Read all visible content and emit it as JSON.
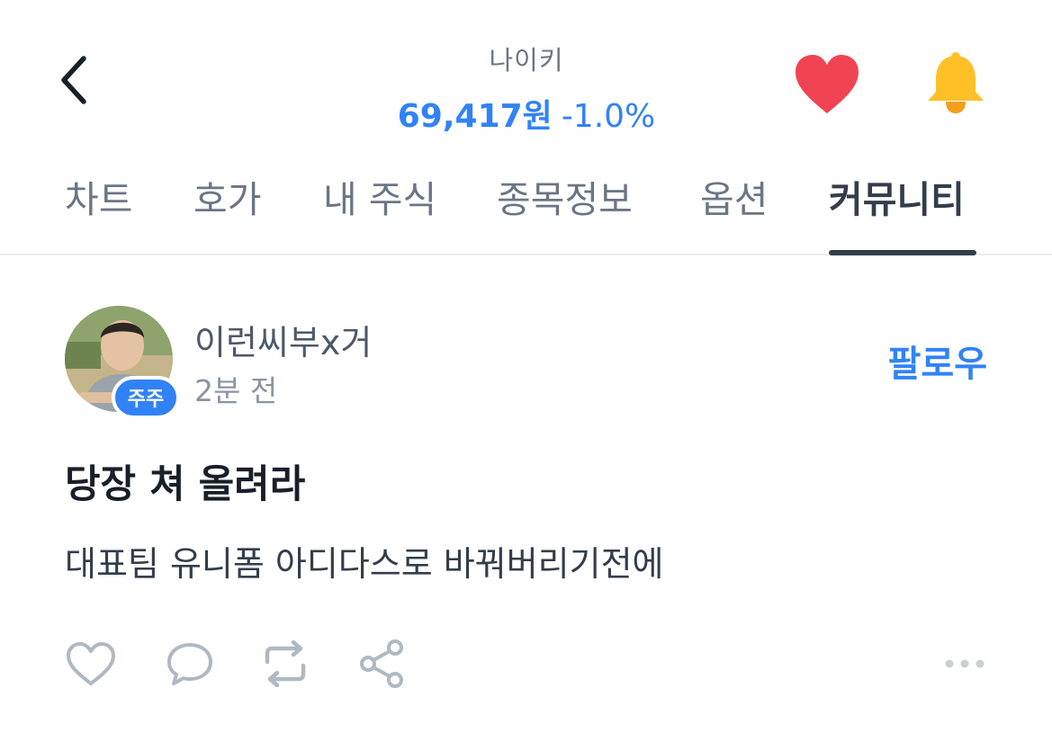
{
  "header": {
    "stock_name": "나이키",
    "price": "69,417원",
    "change": "-1.0%"
  },
  "tabs": [
    {
      "label": "차트",
      "active": false
    },
    {
      "label": "호가",
      "active": false
    },
    {
      "label": "내 주식",
      "active": false
    },
    {
      "label": "종목정보",
      "active": false
    },
    {
      "label": "옵션",
      "active": false
    },
    {
      "label": "커뮤니티",
      "active": true
    }
  ],
  "post": {
    "author": "이런씨부x거",
    "badge": "주주",
    "time": "2분 전",
    "follow_label": "팔로우",
    "title": "당장 쳐 올려라",
    "body": "대표팀 유니폼 아디다스로 바꿔버리기전에"
  },
  "icons": {
    "back": "chevron-left-icon",
    "favorite": "heart-icon",
    "alarm": "bell-icon",
    "like": "heart-outline-icon",
    "comment": "comment-icon",
    "repost": "repost-icon",
    "share": "share-icon",
    "more": "more-horizontal-icon"
  },
  "colors": {
    "accent": "#3182f6",
    "heart": "#f04452",
    "bell": "#ffc027",
    "text_primary": "#191f28",
    "text_secondary": "#6b7684",
    "icon_gray": "#b0b8c1"
  }
}
